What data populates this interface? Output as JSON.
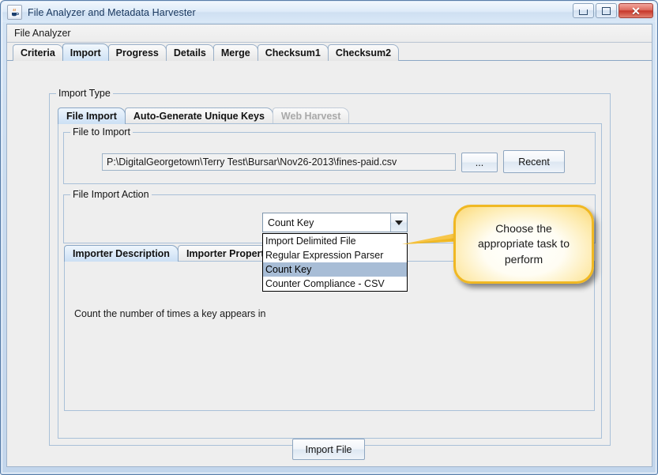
{
  "window": {
    "title": "File Analyzer and Metadata Harvester",
    "icon": "java-coffee-cup-icon",
    "buttons": {
      "minimize": "minimize-button",
      "maximize": "maximize-button",
      "close_glyph": "✕"
    }
  },
  "menubar": {
    "items": [
      {
        "label": "File Analyzer"
      }
    ]
  },
  "tabs": [
    {
      "label": "Criteria",
      "selected": false,
      "disabled": false
    },
    {
      "label": "Import",
      "selected": true,
      "disabled": false
    },
    {
      "label": "Progress",
      "selected": false,
      "disabled": false
    },
    {
      "label": "Details",
      "selected": false,
      "disabled": false
    },
    {
      "label": "Merge",
      "selected": false,
      "disabled": false
    },
    {
      "label": "Checksum1",
      "selected": false,
      "disabled": false
    },
    {
      "label": "Checksum2",
      "selected": false,
      "disabled": false
    }
  ],
  "import_type": {
    "group_title": "Import Type",
    "tabs": [
      {
        "label": "File Import",
        "selected": true,
        "disabled": false
      },
      {
        "label": "Auto-Generate Unique Keys",
        "selected": false,
        "disabled": false
      },
      {
        "label": "Web Harvest",
        "selected": false,
        "disabled": true
      }
    ]
  },
  "file_to_import": {
    "group_title": "File to Import",
    "path_value": "P:\\DigitalGeorgetown\\Terry Test\\Bursar\\Nov26-2013\\fines-paid.csv",
    "browse_label": "...",
    "recent_label": "Recent"
  },
  "file_import_action": {
    "group_title": "File Import Action",
    "combo": {
      "selected_value": "Count Key",
      "arrow_icon": "chevron-down-icon",
      "open": true,
      "options": [
        {
          "label": "Import Delimited File",
          "selected": false
        },
        {
          "label": "Regular Expression Parser",
          "selected": false
        },
        {
          "label": "Count Key",
          "selected": true
        },
        {
          "label": "Counter Compliance - CSV",
          "selected": false
        }
      ]
    }
  },
  "importer_panel": {
    "tabs": [
      {
        "label": "Importer Description",
        "selected": true
      },
      {
        "label": "Importer Properties",
        "selected": false
      }
    ],
    "description_text": "Count the number of times a key appears in"
  },
  "footer": {
    "import_file_label": "Import File"
  },
  "callout": {
    "text": "Choose the appropriate task to perform",
    "fill_color": "#fde9a8",
    "border_color": "#f0b823"
  }
}
